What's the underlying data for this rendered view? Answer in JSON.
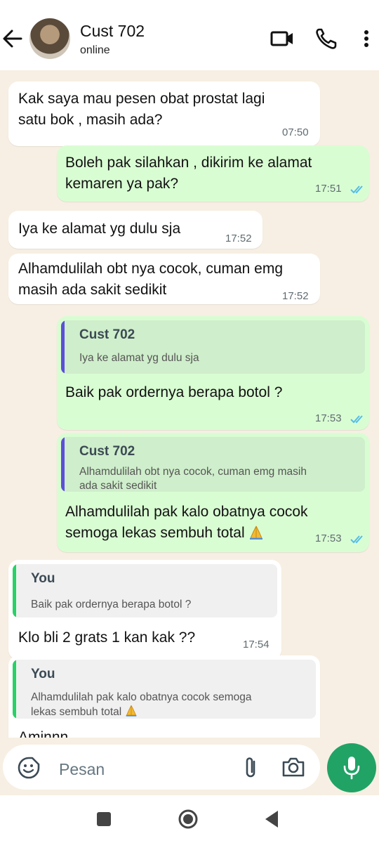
{
  "header": {
    "contact_name": "Cust 702",
    "status": "online",
    "icons": [
      "back-arrow-icon",
      "video-call-icon",
      "voice-call-icon",
      "more-options-icon"
    ]
  },
  "messages": [
    {
      "dir": "in",
      "text": "Kak saya mau pesen obat prostat lagi\nsatu bok , masih ada?",
      "time": "07:50"
    },
    {
      "dir": "out",
      "text": "Boleh pak silahkan , dikirim ke alamat\nkemaren ya pak?",
      "time": "17:51"
    },
    {
      "dir": "in",
      "text": "Iya ke alamat yg dulu sja",
      "time": "17:52"
    },
    {
      "dir": "in",
      "text": "Alhamdulilah obt nya cocok, cuman emg\nmasih ada sakit sedikit",
      "time": "17:52"
    },
    {
      "dir": "out",
      "quote_name": "Cust 702",
      "quote_text": "Iya ke alamat yg dulu sja",
      "text": "Baik pak ordernya berapa botol ?",
      "time": "17:53"
    },
    {
      "dir": "out",
      "quote_name": "Cust 702",
      "quote_text": "Alhamdulilah obt nya cocok, cuman emg masih\nada sakit sedikit",
      "text": "Alhamdulilah pak kalo obatnya cocok\nsemoga lekas sembuh total",
      "time": "17:53"
    },
    {
      "dir": "in",
      "quote_name": "You",
      "quote_text": "Baik pak ordernya berapa botol ?",
      "text": "Klo bli 2 grats 1 kan kak ??",
      "time": "17:54"
    },
    {
      "dir": "in",
      "quote_name": "You",
      "quote_text": "Alhamdulilah pak kalo obatnya cocok semoga\nlekas sembuh total",
      "text": "Aminnn",
      "time": ""
    }
  ],
  "input": {
    "placeholder": "Pesan"
  },
  "colors": {
    "outgoing_bubble": "#d9fdd3",
    "incoming_bubble": "#ffffff",
    "read_ticks": "#53bdeb",
    "mic_button": "#21a366",
    "quote_bar_contact": "#5b4fd9",
    "quote_bar_you": "#25d366"
  }
}
